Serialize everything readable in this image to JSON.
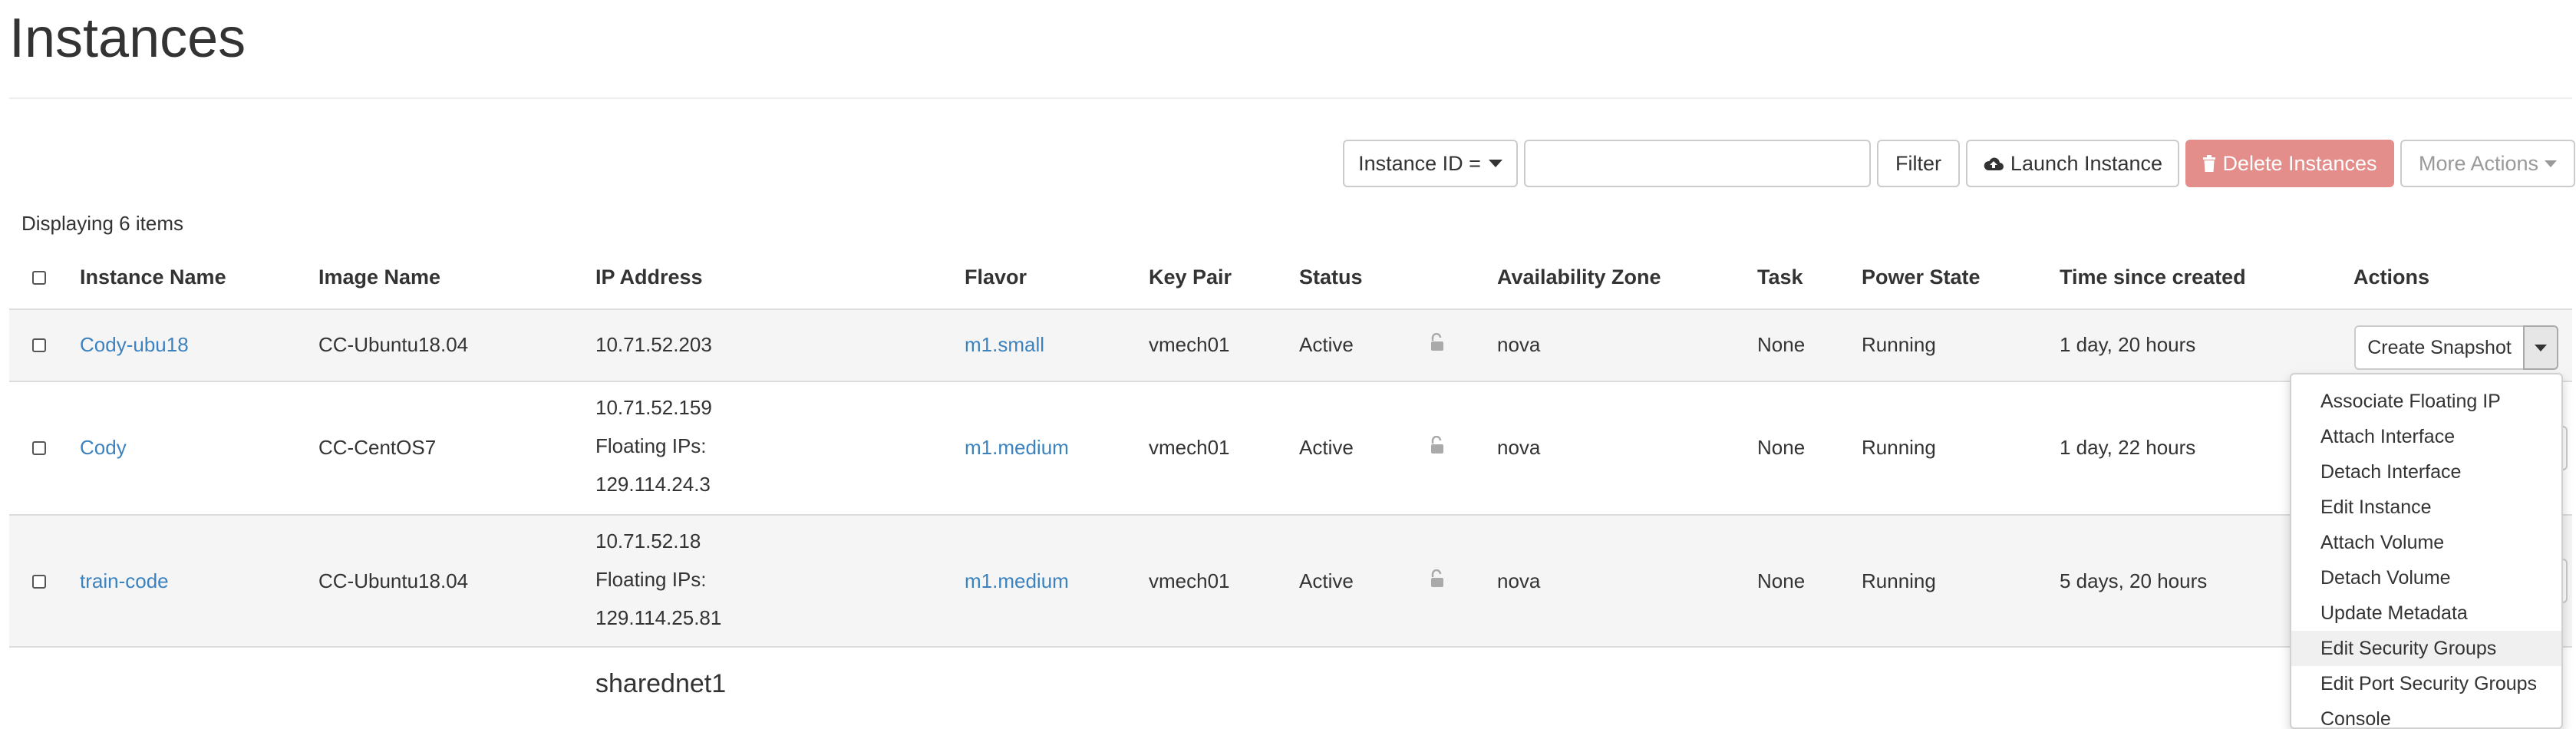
{
  "page": {
    "title": "Instances"
  },
  "toolbar": {
    "filter_field": "Instance ID =",
    "filter_value": "",
    "filter_label": "Filter",
    "launch_label": "Launch Instance",
    "delete_label": "Delete Instances",
    "more_label": "More Actions",
    "colors": {
      "danger": "#e48e8b",
      "link": "#3b82bf"
    }
  },
  "table": {
    "count_text": "Displaying 6 items",
    "columns": [
      "Instance Name",
      "Image Name",
      "IP Address",
      "Flavor",
      "Key Pair",
      "Status",
      "Availability Zone",
      "Task",
      "Power State",
      "Time since created",
      "Actions"
    ],
    "rows": [
      {
        "name": "Cody-ubu18",
        "image": "CC-Ubuntu18.04",
        "ip": [
          "10.71.52.203"
        ],
        "flavor": "m1.small",
        "keypair": "vmech01",
        "status": "Active",
        "zone": "nova",
        "task": "None",
        "power": "Running",
        "age": "1 day, 20 hours"
      },
      {
        "name": "Cody",
        "image": "CC-CentOS7",
        "ip": [
          "10.71.52.159",
          "Floating IPs:",
          "129.114.24.3"
        ],
        "flavor": "m1.medium",
        "keypair": "vmech01",
        "status": "Active",
        "zone": "nova",
        "task": "None",
        "power": "Running",
        "age": "1 day, 22 hours"
      },
      {
        "name": "train-code",
        "image": "CC-Ubuntu18.04",
        "ip": [
          "10.71.52.18",
          "Floating IPs:",
          "129.114.25.81"
        ],
        "flavor": "m1.medium",
        "keypair": "vmech01",
        "status": "Active",
        "zone": "nova",
        "task": "None",
        "power": "Running",
        "age": "5 days, 20 hours"
      }
    ],
    "partial_row_ip": "sharednet1"
  },
  "actions": {
    "primary": "Create Snapshot",
    "menu": [
      "Associate Floating IP",
      "Attach Interface",
      "Detach Interface",
      "Edit Instance",
      "Attach Volume",
      "Detach Volume",
      "Update Metadata",
      "Edit Security Groups",
      "Edit Port Security Groups",
      "Console"
    ],
    "highlighted": "Edit Security Groups"
  }
}
